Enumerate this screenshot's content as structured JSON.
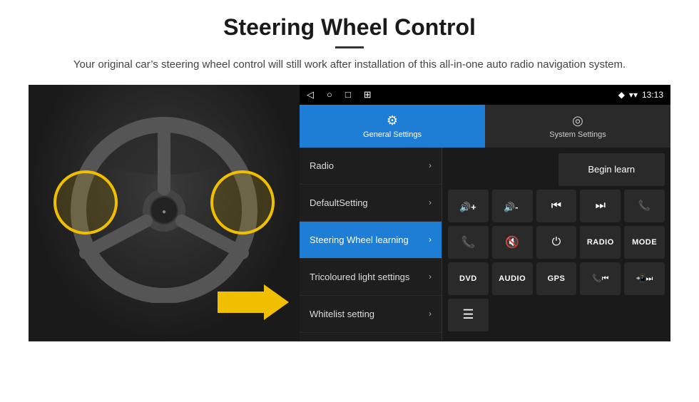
{
  "header": {
    "title": "Steering Wheel Control",
    "divider": true,
    "subtitle": "Your original car’s steering wheel control will still work after installation of this all-in-one auto radio navigation system."
  },
  "status_bar": {
    "nav_icons": [
      "◁",
      "○",
      "□",
      "⊞"
    ],
    "right": {
      "location_icon": "♦",
      "wifi_icon": "▾",
      "time": "13:13"
    }
  },
  "tabs": [
    {
      "id": "general",
      "label": "General Settings",
      "icon": "⚙",
      "active": true
    },
    {
      "id": "system",
      "label": "System Settings",
      "icon": "◉",
      "active": false
    }
  ],
  "menu_items": [
    {
      "label": "Radio",
      "active": false
    },
    {
      "label": "DefaultSetting",
      "active": false
    },
    {
      "label": "Steering Wheel learning",
      "active": true
    },
    {
      "label": "Tricoloured light settings",
      "active": false
    },
    {
      "label": "Whitelist setting",
      "active": false
    }
  ],
  "controls": {
    "begin_learn": "Begin learn",
    "row1": [
      {
        "icon": "🔊+",
        "label": "vol-up"
      },
      {
        "icon": "🔊-",
        "label": "vol-down"
      },
      {
        "icon": "⏮",
        "label": "prev-track"
      },
      {
        "icon": "⏭",
        "label": "next-track"
      },
      {
        "icon": "📞",
        "label": "phone"
      }
    ],
    "row2": [
      {
        "icon": "📞",
        "label": "call"
      },
      {
        "icon": "🔇",
        "label": "mute"
      },
      {
        "icon": "⏻",
        "label": "power"
      },
      {
        "text": "RADIO",
        "label": "radio-btn"
      },
      {
        "text": "MODE",
        "label": "mode-btn"
      }
    ],
    "row3": [
      {
        "text": "DVD",
        "label": "dvd-btn"
      },
      {
        "text": "AUDIO",
        "label": "audio-btn"
      },
      {
        "text": "GPS",
        "label": "gps-btn"
      },
      {
        "icon": "📞⏮",
        "label": "phone-prev"
      },
      {
        "icon": "📲⏭",
        "label": "phone-next"
      }
    ],
    "row4": [
      {
        "icon": "☰",
        "label": "list-icon"
      }
    ]
  }
}
